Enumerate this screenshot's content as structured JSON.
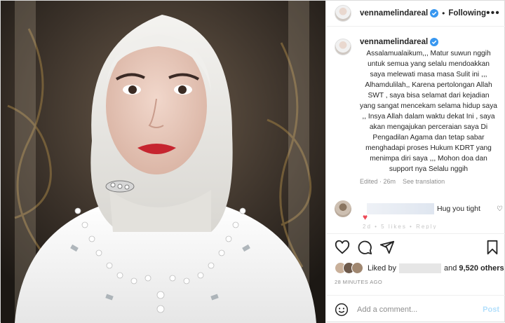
{
  "post": {
    "username": "vennamelindareal",
    "follow_status": "Following",
    "separator": "•",
    "more_glyph": "•••"
  },
  "caption": {
    "username": "vennamelindareal",
    "text": "Assalamualaikum,,, Matur suwun nggih untuk semua yang selalu mendoakkan saya melewati masa masa Sulit ini ,,, Alhamdulilah,, Karena pertolongan Allah SWT , saya bisa selamat dari kejadian yang sangat mencekam selama hidup saya ,, Insya Allah dalam waktu dekat Ini , saya akan mengajukan perceraian saya Di Pengadilan Agama dan tetap sabar menghadapi proses Hukum KDRT yang menimpa diri saya ,,, Mohon doa dan support nya Selalu nggih",
    "edited": "Edited",
    "age": "26m",
    "see_translation": "See translation"
  },
  "comment": {
    "text": "Hug you tight",
    "heart": "♥",
    "like_glyph": "♡",
    "faded_text": "2d  •  5 likes  •  Reply"
  },
  "icons": {
    "like": "heart-icon",
    "comment": "comment-icon",
    "share": "share-icon",
    "save": "bookmark-icon"
  },
  "likes": {
    "prefix": "Liked by",
    "connector": "and",
    "count": "9,520 others"
  },
  "timestamp": "28 MINUTES AGO",
  "add_comment": {
    "placeholder": "Add a comment...",
    "post_label": "Post"
  },
  "colors": {
    "verified": "#3897f0",
    "heart_red": "#ed4956",
    "post_button": "#b2dffc",
    "muted": "#8e8e8e"
  }
}
